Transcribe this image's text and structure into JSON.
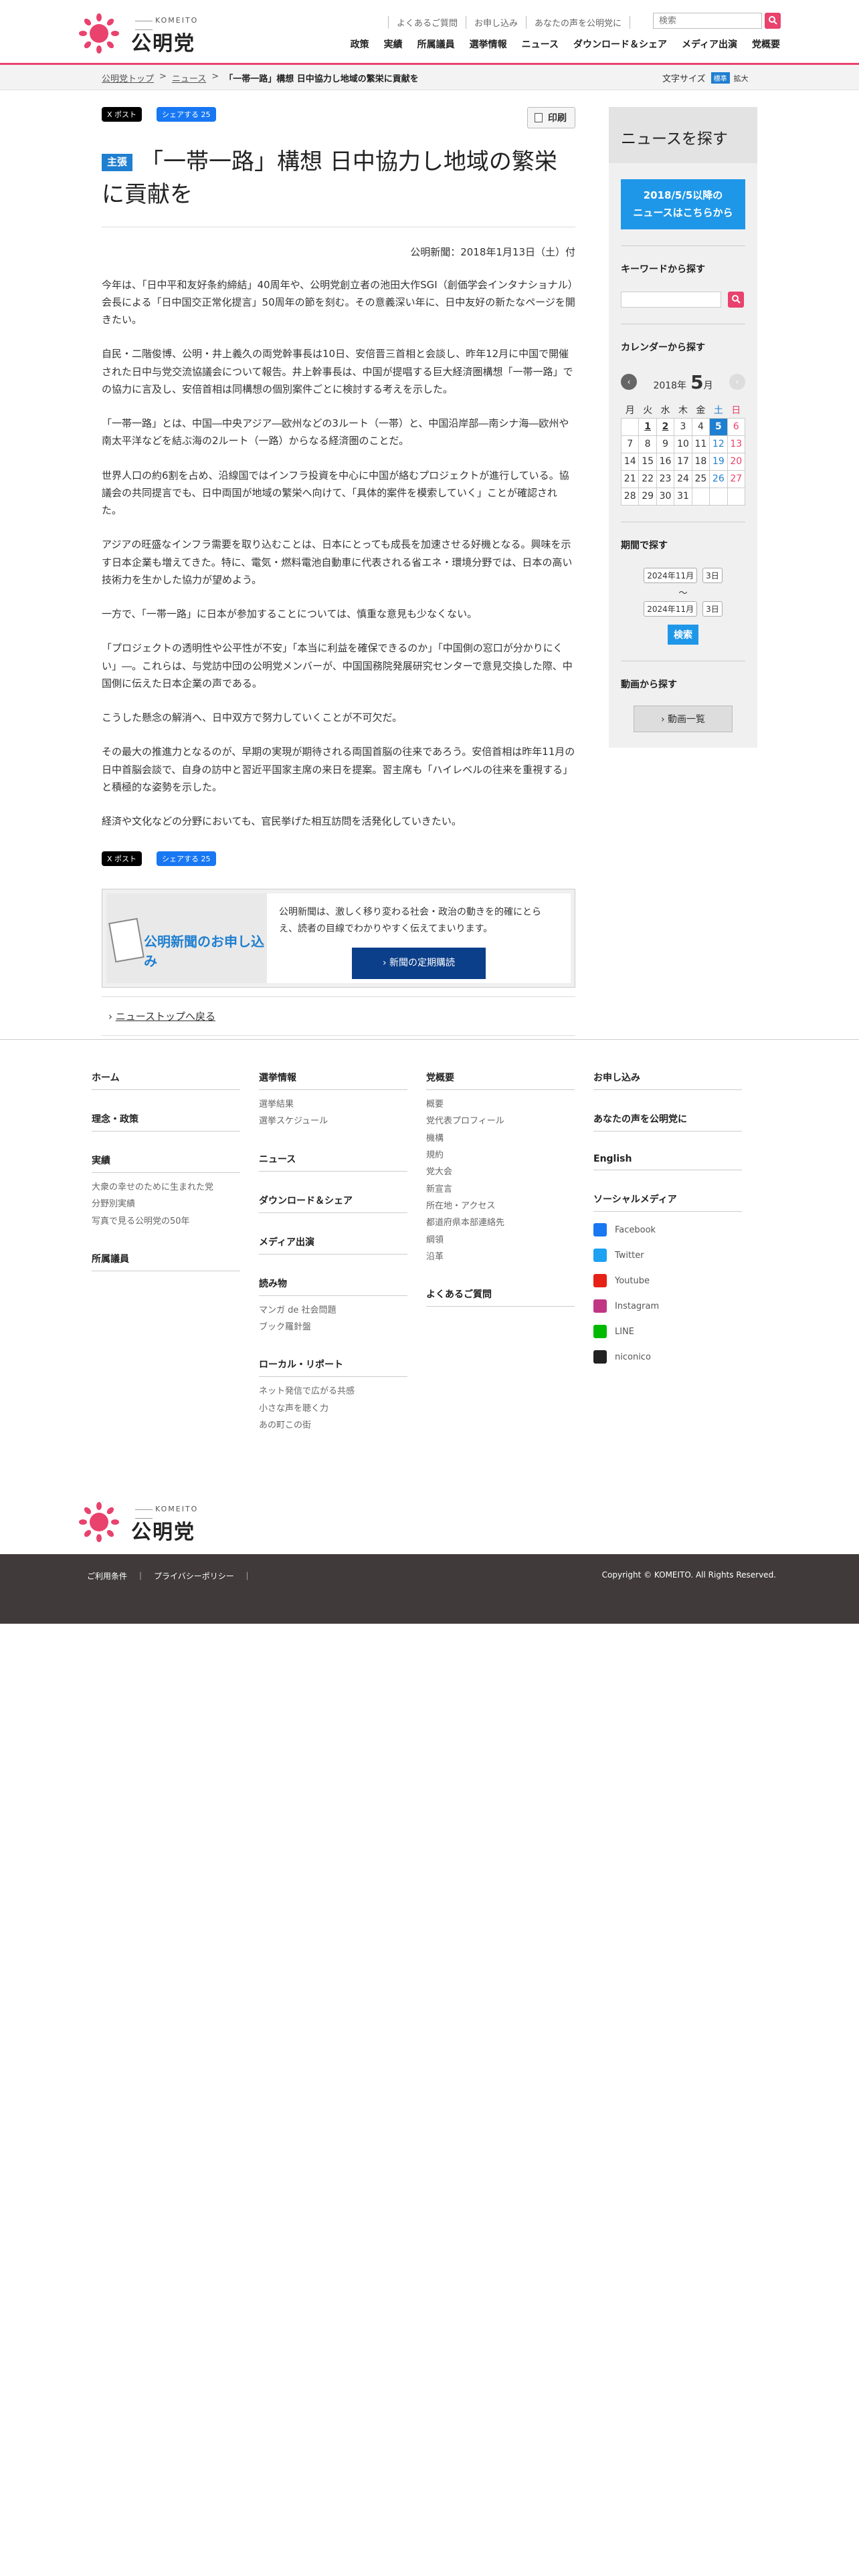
{
  "header": {
    "logo_en": "KOMEITO",
    "logo_jp": "公明党",
    "util_links": [
      "よくあるご質問",
      "お申し込み",
      "あなたの声を公明党に"
    ],
    "search_placeholder": "検索",
    "nav": [
      "政策",
      "実績",
      "所属議員",
      "選挙情報",
      "ニュース",
      "ダウンロード＆シェア",
      "メディア出演",
      "党概要"
    ]
  },
  "breadcrumb": {
    "home": "公明党トップ",
    "news": "ニュース",
    "current": "「一帯一路」構想 日中協力し地域の繁栄に貢献を"
  },
  "font_size": {
    "label": "文字サイズ",
    "standard": "標準",
    "large": "拡大"
  },
  "share": {
    "x": "X ポスト",
    "facebook": "シェアする 25"
  },
  "print": "印刷",
  "article": {
    "badge": "主張",
    "title": "「一帯一路」構想 日中協力し地域の繁栄に貢献を",
    "dateline": "公明新聞：2018年1月13日（土）付",
    "paragraphs": [
      "今年は、「日中平和友好条約締結」40周年や、公明党創立者の池田大作SGI（創価学会インタナショナル）会長による「日中国交正常化提言」50周年の節を刻む。その意義深い年に、日中友好の新たなページを開きたい。",
      "自民・二階俊博、公明・井上義久の両党幹事長は10日、安倍晋三首相と会談し、昨年12月に中国で開催された日中与党交流協議会について報告。井上幹事長は、中国が提唱する巨大経済圏構想「一帯一路」での協力に言及し、安倍首相は同構想の個別案件ごとに検討する考えを示した。",
      "「一帯一路」とは、中国―中央アジア―欧州などの3ルート（一帯）と、中国沿岸部―南シナ海―欧州や南太平洋などを結ぶ海の2ルート（一路）からなる経済圏のことだ。",
      "世界人口の約6割を占め、沿線国ではインフラ投資を中心に中国が絡むプロジェクトが進行している。協議会の共同提言でも、日中両国が地域の繁栄へ向けて、「具体的案件を模索していく」ことが確認された。",
      "アジアの旺盛なインフラ需要を取り込むことは、日本にとっても成長を加速させる好機となる。興味を示す日本企業も増えてきた。特に、電気・燃料電池自動車に代表される省エネ・環境分野では、日本の高い技術力を生かした協力が望めよう。",
      "一方で、「一帯一路」に日本が参加することについては、慎重な意見も少なくない。",
      "「プロジェクトの透明性や公平性が不安」「本当に利益を確保できるのか」「中国側の窓口が分かりにくい」―。これらは、与党訪中団の公明党メンバーが、中国国務院発展研究センターで意見交換した際、中国側に伝えた日本企業の声である。",
      "こうした懸念の解消へ、日中双方で努力していくことが不可欠だ。",
      "その最大の推進力となるのが、早期の実現が期待される両国首脳の往来であろう。安倍首相は昨年11月の日中首脳会談で、自身の訪中と習近平国家主席の来日を提案。習主席も「ハイレベルの往来を重視する」と積極的な姿勢を示した。",
      "経済や文化などの分野においても、官民挙げた相互訪問を活発化していきたい。"
    ]
  },
  "subscribe": {
    "banner": "公明新聞のお申し込み",
    "text": "公明新聞は、激しく移り変わる社会・政治の動きを的確にとらえ、読者の目線でわかりやすく伝えてまいります。",
    "button": "› 新聞の定期購読"
  },
  "back_to_top": "ニューストップへ戻る",
  "sidebar": {
    "title": "ニュースを探す",
    "news_after_line1": "2018/5/5以降の",
    "news_after_line2": "ニュースはこちらから",
    "keyword_label": "キーワードから探す",
    "calendar_label": "カレンダーから探す",
    "calendar_year": "2018年",
    "calendar_month": "5",
    "calendar_month_suffix": "月",
    "weekdays": [
      "月",
      "火",
      "水",
      "木",
      "金",
      "土",
      "日"
    ],
    "weeks": [
      [
        "",
        "1",
        "2",
        "3",
        "4",
        "5",
        "6"
      ],
      [
        "7",
        "8",
        "9",
        "10",
        "11",
        "12",
        "13"
      ],
      [
        "14",
        "15",
        "16",
        "17",
        "18",
        "19",
        "20"
      ],
      [
        "21",
        "22",
        "23",
        "24",
        "25",
        "26",
        "27"
      ],
      [
        "28",
        "29",
        "30",
        "31",
        "",
        "",
        ""
      ]
    ],
    "today": "5",
    "linked_days": [
      "1",
      "2"
    ],
    "period_label": "期間で探す",
    "period_from_ym": "2024年11月",
    "period_from_d": "3日",
    "period_tilde": "〜",
    "period_to_ym": "2024年11月",
    "period_to_d": "3日",
    "period_button": "検索",
    "video_label": "動画から探す",
    "video_button": "› 動画一覧"
  },
  "footer": {
    "col1": [
      {
        "head": "ホーム",
        "links": []
      },
      {
        "head": "理念・政策",
        "links": []
      },
      {
        "head": "実績",
        "links": [
          "大衆の幸せのために生まれた党",
          "分野別実績",
          "写真で見る公明党の50年"
        ]
      },
      {
        "head": "所属議員",
        "links": []
      }
    ],
    "col2": [
      {
        "head": "選挙情報",
        "links": [
          "選挙結果",
          "選挙スケジュール"
        ]
      },
      {
        "head": "ニュース",
        "links": []
      },
      {
        "head": "ダウンロード＆シェア",
        "links": []
      },
      {
        "head": "メディア出演",
        "links": []
      },
      {
        "head": "読み物",
        "links": [
          "マンガ de 社会問題",
          "ブック羅針盤"
        ]
      },
      {
        "head": "ローカル・リポート",
        "links": [
          "ネット発信で広がる共感",
          "小さな声を聴く力",
          "あの町この街"
        ]
      }
    ],
    "col3": [
      {
        "head": "党概要",
        "links": [
          "概要",
          "党代表プロフィール",
          "機構",
          "規約",
          "党大会",
          "新宣言",
          "所在地・アクセス",
          "都道府県本部連絡先",
          "綱領",
          "沿革"
        ]
      },
      {
        "head": "よくあるご質問",
        "links": []
      }
    ],
    "col4": [
      {
        "head": "お申し込み",
        "links": []
      },
      {
        "head": "あなたの声を公明党に",
        "links": []
      },
      {
        "head": "English",
        "links": []
      }
    ],
    "social_head": "ソーシャルメディア",
    "social": [
      {
        "name": "Facebook",
        "color": "#1877f2"
      },
      {
        "name": "Twitter",
        "color": "#1da1f2"
      },
      {
        "name": "Youtube",
        "color": "#e62117"
      },
      {
        "name": "Instagram",
        "color": "#c13584"
      },
      {
        "name": "LINE",
        "color": "#00b900"
      },
      {
        "name": "niconico",
        "color": "#222222"
      }
    ],
    "bottom_links": [
      "ご利用条件",
      "｜",
      "プライバシーポリシー",
      "｜"
    ],
    "copyright": "Copyright © KOMEITO. All Rights Reserved."
  },
  "colors": {
    "accent": "#e8426d",
    "blue": "#1f7fd0",
    "footer_bg": "#403a3a"
  }
}
